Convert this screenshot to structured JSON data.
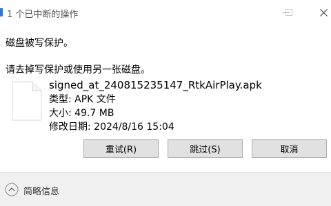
{
  "window": {
    "title": "1 个已中断的操作"
  },
  "message": {
    "line1": "磁盘被写保护。",
    "line2": "请去掉写保护或使用另一张磁盘。"
  },
  "file": {
    "name": "signed_at_240815235147_RtkAirPlay.apk",
    "type": "类型: APK 文件",
    "size": "大小: 49.7 MB",
    "modified": "修改日期: 2024/8/16 15:04",
    "icon": "document-icon"
  },
  "buttons": {
    "retry": "重试(R)",
    "skip": "跳过(S)",
    "cancel": "取消"
  },
  "footer": {
    "details_label": "简略信息",
    "icon": "chevron-up-icon"
  },
  "colors": {
    "button_bg": "#e1e1e1",
    "button_border": "#adadad",
    "footer_bg": "#f0f0f0",
    "title_text": "#555555"
  }
}
